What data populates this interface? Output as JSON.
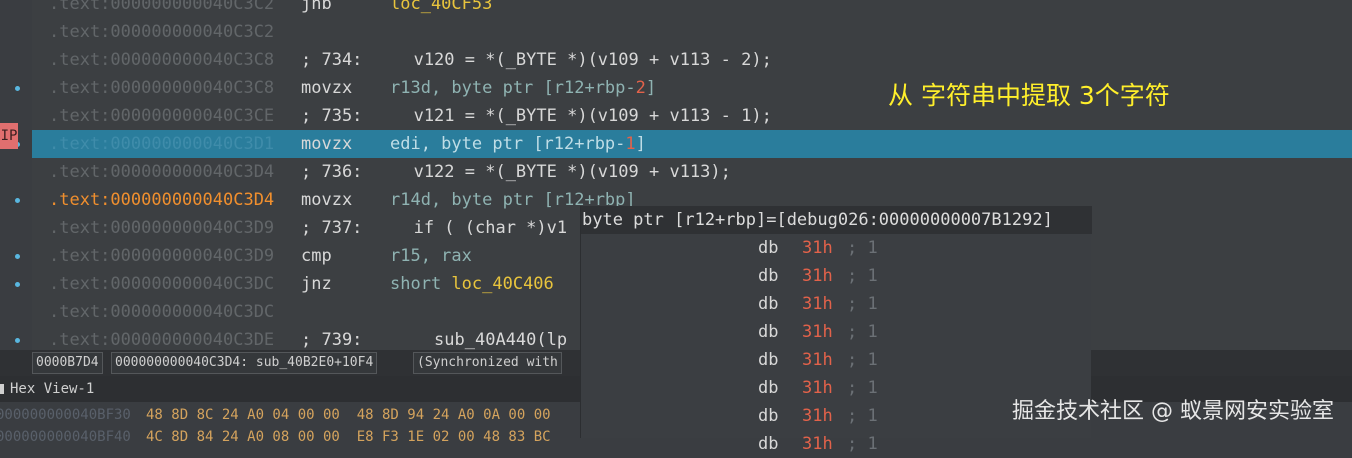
{
  "disasm": {
    "lines": [
      {
        "addr": ".text:000000000040C3C2",
        "kind": "instr",
        "mnem": "jnb",
        "ops": "loc_40CF53",
        "dot": false
      },
      {
        "addr": ".text:000000000040C3C2",
        "kind": "blank",
        "dot": false
      },
      {
        "addr": ".text:000000000040C3C8",
        "kind": "comment",
        "text": "; 734:     v120 = *(_BYTE *)(v109 + v113 - 2);",
        "dot": false
      },
      {
        "addr": ".text:000000000040C3C8",
        "kind": "instr",
        "mnem": "movzx",
        "ops_pre": "r13d, byte ptr [r12+rbp-",
        "ops_num": "2",
        "ops_post": "]",
        "dot": true
      },
      {
        "addr": ".text:000000000040C3CE",
        "kind": "comment",
        "text": "; 735:     v121 = *(_BYTE *)(v109 + v113 - 1);",
        "dot": false
      },
      {
        "addr": ".text:000000000040C3D1",
        "kind": "instr",
        "mnem": "movzx",
        "ops_pre": "edi, byte ptr [r12+rbp-",
        "ops_num": "1",
        "ops_post": "]",
        "dot": true,
        "highlight": true
      },
      {
        "addr": ".text:000000000040C3D4",
        "kind": "comment",
        "text": "; 736:     v122 = *(_BYTE *)(v109 + v113);",
        "dot": false
      },
      {
        "addr": ".text:000000000040C3D4",
        "kind": "instr",
        "mnem": "movzx",
        "ops_pre": "r14d, byte ptr [r12+rbp]",
        "dot": true,
        "current": true
      },
      {
        "addr": ".text:000000000040C3D9",
        "kind": "comment",
        "text": "; 737:     if ( (char *)v1",
        "dot": false
      },
      {
        "addr": ".text:000000000040C3D9",
        "kind": "instr",
        "mnem": "cmp",
        "ops_pre": "r15, rax",
        "dot": true
      },
      {
        "addr": ".text:000000000040C3DC",
        "kind": "instr",
        "mnem": "jnz",
        "ops_pre": "short ",
        "ops_label": "loc_40C406",
        "dot": true
      },
      {
        "addr": ".text:000000000040C3DC",
        "kind": "blank",
        "dot": false
      },
      {
        "addr": ".text:000000000040C3DE",
        "kind": "comment",
        "text": "; 739:       sub_40A440(lp",
        "dot": true
      }
    ],
    "ip_label": "IP"
  },
  "annotation": "从 字符串中提取 3个字符",
  "status": {
    "offset": "0000B7D4",
    "location": "000000000040C3D4: sub_40B2E0+10F4",
    "sync": "(Synchronized with"
  },
  "hexview": {
    "title": "Hex View-1",
    "icon": "hex-view-icon",
    "rows": [
      {
        "addr": "000000000040BF30",
        "bytes": "48 8D 8C 24 A0 04 00 00  48 8D 94 24 A0 0A 00 00"
      },
      {
        "addr": "000000000040BF40",
        "bytes": "4C 8D 84 24 A0 08 00 00  E8 F3 1E 02 00 48 83 BC"
      }
    ]
  },
  "popup": {
    "header": "byte ptr [r12+rbp]=[debug026:00000000007B1292]",
    "rows": [
      {
        "dir": "db",
        "val": "31h",
        "cmt": "; 1"
      },
      {
        "dir": "db",
        "val": "31h",
        "cmt": "; 1"
      },
      {
        "dir": "db",
        "val": "31h",
        "cmt": "; 1"
      },
      {
        "dir": "db",
        "val": "31h",
        "cmt": "; 1"
      },
      {
        "dir": "db",
        "val": "31h",
        "cmt": "; 1"
      },
      {
        "dir": "db",
        "val": "31h",
        "cmt": "; 1"
      },
      {
        "dir": "db",
        "val": "31h",
        "cmt": "; 1"
      },
      {
        "dir": "db",
        "val": "31h",
        "cmt": "; 1"
      }
    ]
  },
  "watermark": "掘金技术社区 @ 蚁景网安实验室"
}
